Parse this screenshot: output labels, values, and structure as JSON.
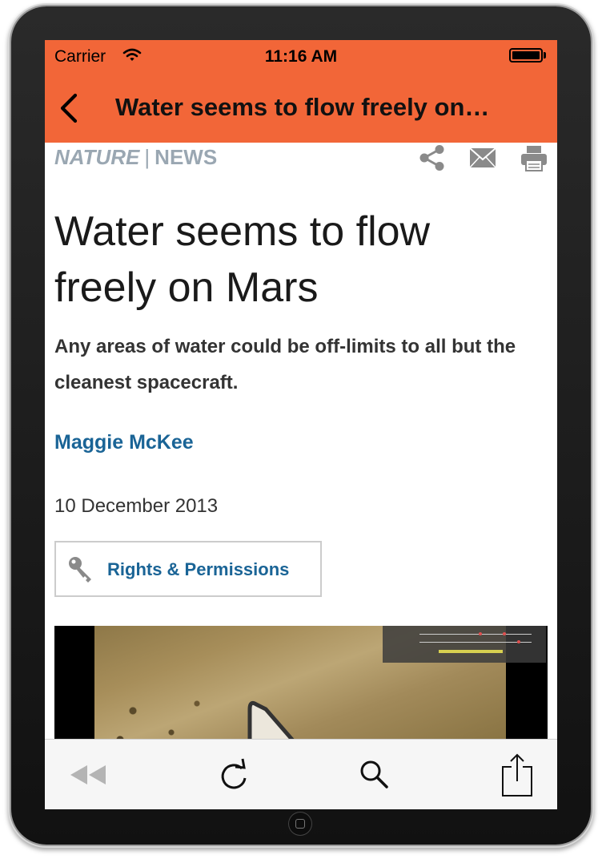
{
  "status_bar": {
    "carrier": "Carrier",
    "time": "11:16 AM"
  },
  "nav": {
    "title": "Water seems to flow freely on…",
    "back_icon": "chevron-left-icon"
  },
  "article": {
    "brand_nature": "NATURE",
    "brand_sep": "|",
    "brand_section": "NEWS",
    "headline": "Water seems to flow freely on Mars",
    "standfirst": "Any areas of water could be off-limits to all but the cleanest spacecraft.",
    "author": "Maggie McKee",
    "date": "10 December 2013",
    "rights_label": "Rights & Permissions",
    "tools": [
      "share-icon",
      "mail-icon",
      "print-icon"
    ]
  },
  "toolbar": {
    "items": [
      "rewind-icon",
      "reload-icon",
      "search-icon",
      "share-icon"
    ]
  },
  "colors": {
    "accent": "#f26638",
    "link": "#1a6496",
    "brand": "#9aa7b2"
  }
}
